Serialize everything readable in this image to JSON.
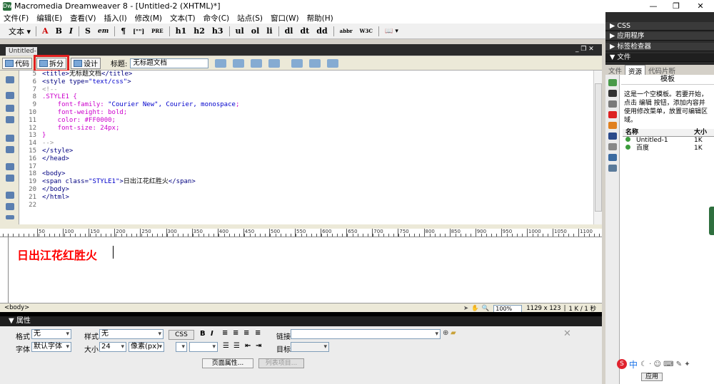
{
  "window": {
    "title": "Macromedia Dreamweaver 8 - [Untitled-2 (XHTML)*]",
    "app_icon": "dw-icon",
    "minimize": "—",
    "maximize": "❐",
    "close": "✕"
  },
  "menu": [
    "文件(F)",
    "编辑(E)",
    "查看(V)",
    "插入(I)",
    "修改(M)",
    "文本(T)",
    "命令(C)",
    "站点(S)",
    "窗口(W)",
    "帮助(H)"
  ],
  "insert_bar": {
    "category": "文本 ▾",
    "items": [
      "A",
      "B",
      "I",
      "S",
      "em",
      "¶",
      "[\"\"]",
      "PRE",
      "h1",
      "h2",
      "h3",
      "ul",
      "ol",
      "li",
      "dl",
      "dt",
      "dd",
      "abbr",
      "W3C",
      "📖 ▾"
    ]
  },
  "document": {
    "tab_label": "Untitled-2",
    "view_buttons": [
      "代码",
      "拆分",
      "设计"
    ],
    "title_label": "标题:",
    "title_value": "无标题文档"
  },
  "code_lines": [
    {
      "n": "5",
      "html": "<span class='tag'>&lt;title&gt;</span>无标题文档<span class='tag'>&lt;/title&gt;</span>"
    },
    {
      "n": "6",
      "html": "<span class='tag'>&lt;style type=<span class='str'>\"text/css\"</span>&gt;</span>"
    },
    {
      "n": "7",
      "html": "<span class='cmt'>&lt;!--</span>"
    },
    {
      "n": "8",
      "html": "<span class='css'>.STYLE1 {</span>"
    },
    {
      "n": "9",
      "html": "<span class='css'>    font-family: </span><span class='str'>\"Courier New\", Courier, monospace</span><span class='css'>;</span>"
    },
    {
      "n": "10",
      "html": "<span class='css'>    font-weight: bold;</span>"
    },
    {
      "n": "11",
      "html": "<span class='css'>    color: #FF0000;</span>"
    },
    {
      "n": "12",
      "html": "<span class='css'>    font-size: 24px;</span>"
    },
    {
      "n": "13",
      "html": "<span class='css'>}</span>"
    },
    {
      "n": "14",
      "html": "<span class='cmt'>--&gt;</span>"
    },
    {
      "n": "15",
      "html": "<span class='tag'>&lt;/style&gt;</span>"
    },
    {
      "n": "16",
      "html": "<span class='tag'>&lt;/head&gt;</span>"
    },
    {
      "n": "17",
      "html": ""
    },
    {
      "n": "18",
      "html": "<span class='tag'>&lt;body&gt;</span>"
    },
    {
      "n": "19",
      "html": "<span class='tag'>&lt;span class=<span class='str'>\"STYLE1\"</span>&gt;</span>日出江花红胜火<span class='tag'>&lt;/span&gt;</span>"
    },
    {
      "n": "20",
      "html": "<span class='tag'>&lt;/body&gt;</span>"
    },
    {
      "n": "21",
      "html": "<span class='tag'>&lt;/html&gt;</span>"
    },
    {
      "n": "22",
      "html": ""
    }
  ],
  "ruler_ticks": [
    "50",
    "100",
    "150",
    "200",
    "250",
    "300",
    "350",
    "400",
    "450",
    "500",
    "550",
    "600",
    "650",
    "700",
    "750",
    "800",
    "850",
    "900",
    "950",
    "1000",
    "1050",
    "1100"
  ],
  "design_text": "日出江花红胜火",
  "status": {
    "tag_selector": "<body>",
    "zoom": "100%",
    "window_size": "1129 x 123",
    "download": "1 K / 1 秒"
  },
  "properties": {
    "header": "▼ 属性",
    "format_label": "格式",
    "format_value": "无",
    "style_label": "样式",
    "style_value": "无",
    "css_button": "CSS",
    "link_label": "链接",
    "font_label": "字体",
    "font_value": "默认字体",
    "size_label": "大小",
    "size_value": "24",
    "unit_value": "像素(px)",
    "target_label": "目标",
    "page_props_button": "页面属性...",
    "list_item_button": "列表项目..."
  },
  "right_panel": {
    "css": "▶ CSS",
    "app": "▶ 应用程序",
    "tag_inspector": "▶ 标签检查器",
    "files": "▼ 文件",
    "tabs": [
      "文件",
      "资源",
      "代码片断"
    ],
    "active_tab": "资源",
    "section": "模板",
    "preview_text": "这是一个空模板。若要开始，点击 编辑 按钮，添加内容并使用修改菜单，放置可编辑区域。",
    "col_name": "名称",
    "col_size": "大小",
    "rows": [
      {
        "name": "Untitled-1",
        "size": "1K"
      },
      {
        "name": "百度",
        "size": "1K"
      }
    ],
    "apply": "应用"
  },
  "ime": {
    "lang": "中"
  }
}
